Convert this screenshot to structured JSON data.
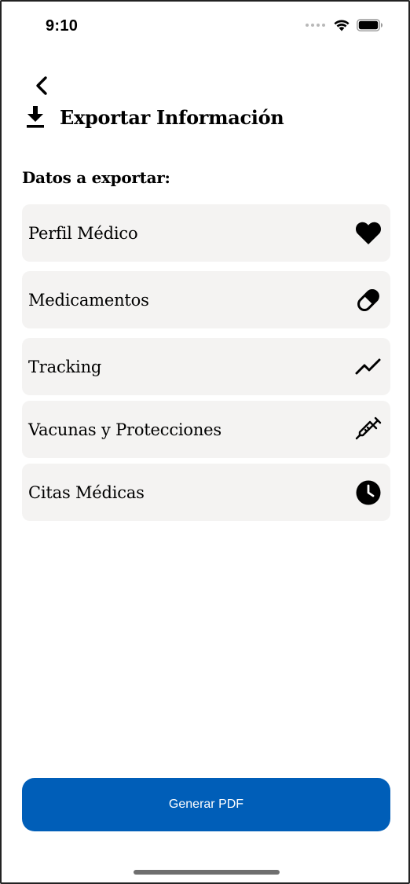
{
  "status_bar": {
    "time": "9:10",
    "icons": [
      "signal-dots-icon",
      "wifi-icon",
      "battery-icon"
    ]
  },
  "nav": {
    "back_icon": "chevron-left-icon"
  },
  "header": {
    "icon": "download-icon",
    "title": "Exportar Información"
  },
  "section": {
    "label": "Datos a exportar:"
  },
  "items": [
    {
      "label": "Perfil Médico",
      "icon": "heart-icon"
    },
    {
      "label": "Medicamentos",
      "icon": "pill-icon"
    },
    {
      "label": "Tracking",
      "icon": "trend-line-icon"
    },
    {
      "label": "Vacunas y Protecciones",
      "icon": "syringe-icon"
    },
    {
      "label": "Citas Médicas",
      "icon": "clock-icon"
    }
  ],
  "action": {
    "label": "Generar PDF",
    "color": "#005eb8"
  },
  "colors": {
    "item_background": "#f4f3f2",
    "text": "#000000"
  }
}
